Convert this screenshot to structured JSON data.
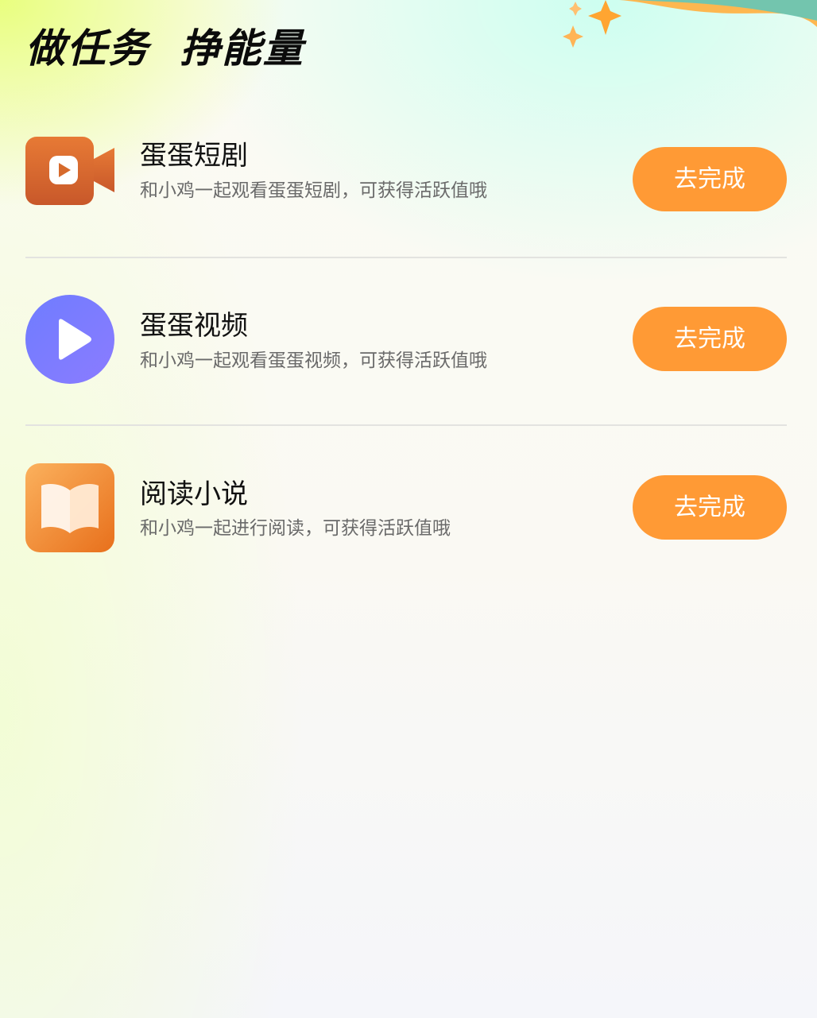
{
  "header": {
    "title": "做任务  挣能量"
  },
  "tasks": [
    {
      "name": "蛋蛋短剧",
      "desc": "和小鸡一起观看蛋蛋短剧，可获得活跃值哦",
      "button": "去完成",
      "icon": "video-camera-icon"
    },
    {
      "name": "蛋蛋视频",
      "desc": "和小鸡一起观看蛋蛋视频，可获得活跃值哦",
      "button": "去完成",
      "icon": "play-icon"
    },
    {
      "name": "阅读小说",
      "desc": "和小鸡一起进行阅读，可获得活跃值哦",
      "button": "去完成",
      "icon": "book-icon"
    }
  ],
  "colors": {
    "accent": "#ff9a35",
    "video_icon": "#d96a2a",
    "play_icon": "#7b7bff",
    "book_icon": "#f0852a"
  }
}
